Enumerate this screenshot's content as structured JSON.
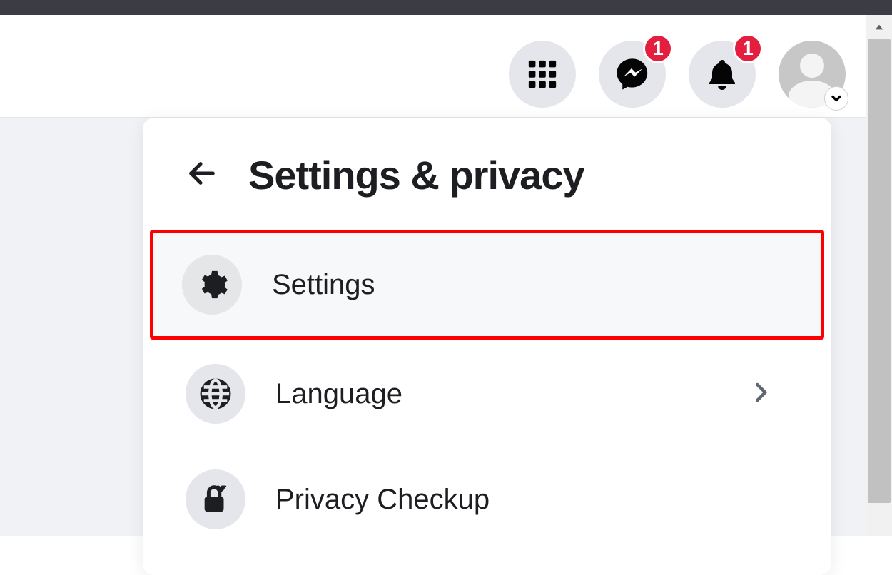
{
  "header": {
    "messenger_badge": "1",
    "notifications_badge": "1"
  },
  "panel": {
    "title": "Settings & privacy"
  },
  "menu": {
    "items": [
      {
        "label": "Settings"
      },
      {
        "label": "Language"
      },
      {
        "label": "Privacy Checkup"
      }
    ]
  }
}
